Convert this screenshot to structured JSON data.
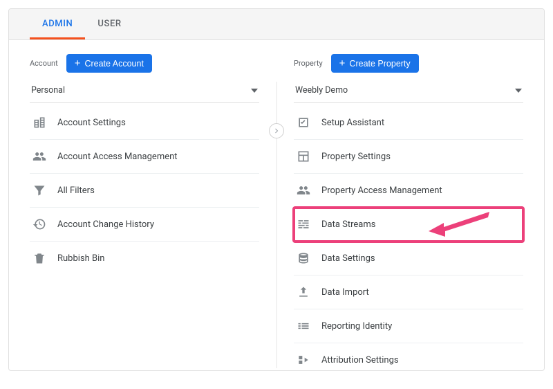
{
  "tabs": {
    "admin": "ADMIN",
    "user": "USER"
  },
  "account": {
    "label": "Account",
    "create_label": "Create Account",
    "selected": "Personal",
    "items": [
      {
        "label": "Account Settings"
      },
      {
        "label": "Account Access Management"
      },
      {
        "label": "All Filters"
      },
      {
        "label": "Account Change History"
      },
      {
        "label": "Rubbish Bin"
      }
    ]
  },
  "property": {
    "label": "Property",
    "create_label": "Create Property",
    "selected": "Weebly Demo",
    "items": [
      {
        "label": "Setup Assistant"
      },
      {
        "label": "Property Settings"
      },
      {
        "label": "Property Access Management"
      },
      {
        "label": "Data Streams"
      },
      {
        "label": "Data Settings"
      },
      {
        "label": "Data Import"
      },
      {
        "label": "Reporting Identity"
      },
      {
        "label": "Attribution Settings"
      }
    ]
  }
}
